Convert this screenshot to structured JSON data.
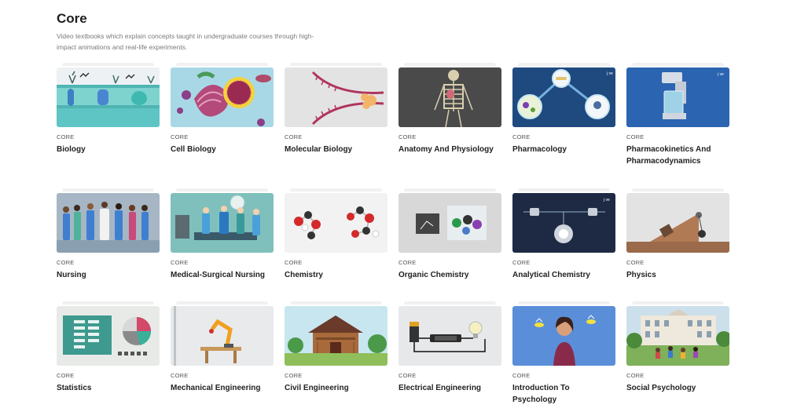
{
  "page": {
    "title": "Core",
    "description": "Video textbooks which explain concepts taught in undergraduate courses through high-impact animations and real-life experiments."
  },
  "courses": [
    {
      "tag": "CORE",
      "title": "Biology"
    },
    {
      "tag": "CORE",
      "title": "Cell Biology"
    },
    {
      "tag": "CORE",
      "title": "Molecular Biology"
    },
    {
      "tag": "CORE",
      "title": "Anatomy And Physiology"
    },
    {
      "tag": "CORE",
      "title": "Pharmacology"
    },
    {
      "tag": "CORE",
      "title": "Pharmacokinetics And Pharmacodynamics"
    },
    {
      "tag": "CORE",
      "title": "Nursing"
    },
    {
      "tag": "CORE",
      "title": "Medical-Surgical Nursing"
    },
    {
      "tag": "CORE",
      "title": "Chemistry"
    },
    {
      "tag": "CORE",
      "title": "Organic Chemistry"
    },
    {
      "tag": "CORE",
      "title": "Analytical Chemistry"
    },
    {
      "tag": "CORE",
      "title": "Physics"
    },
    {
      "tag": "CORE",
      "title": "Statistics"
    },
    {
      "tag": "CORE",
      "title": "Mechanical Engineering"
    },
    {
      "tag": "CORE",
      "title": "Civil Engineering"
    },
    {
      "tag": "CORE",
      "title": "Electrical Engineering"
    },
    {
      "tag": "CORE",
      "title": "Introduction To Psychology"
    },
    {
      "tag": "CORE",
      "title": "Social Psychology"
    }
  ],
  "watermark": "j ve"
}
